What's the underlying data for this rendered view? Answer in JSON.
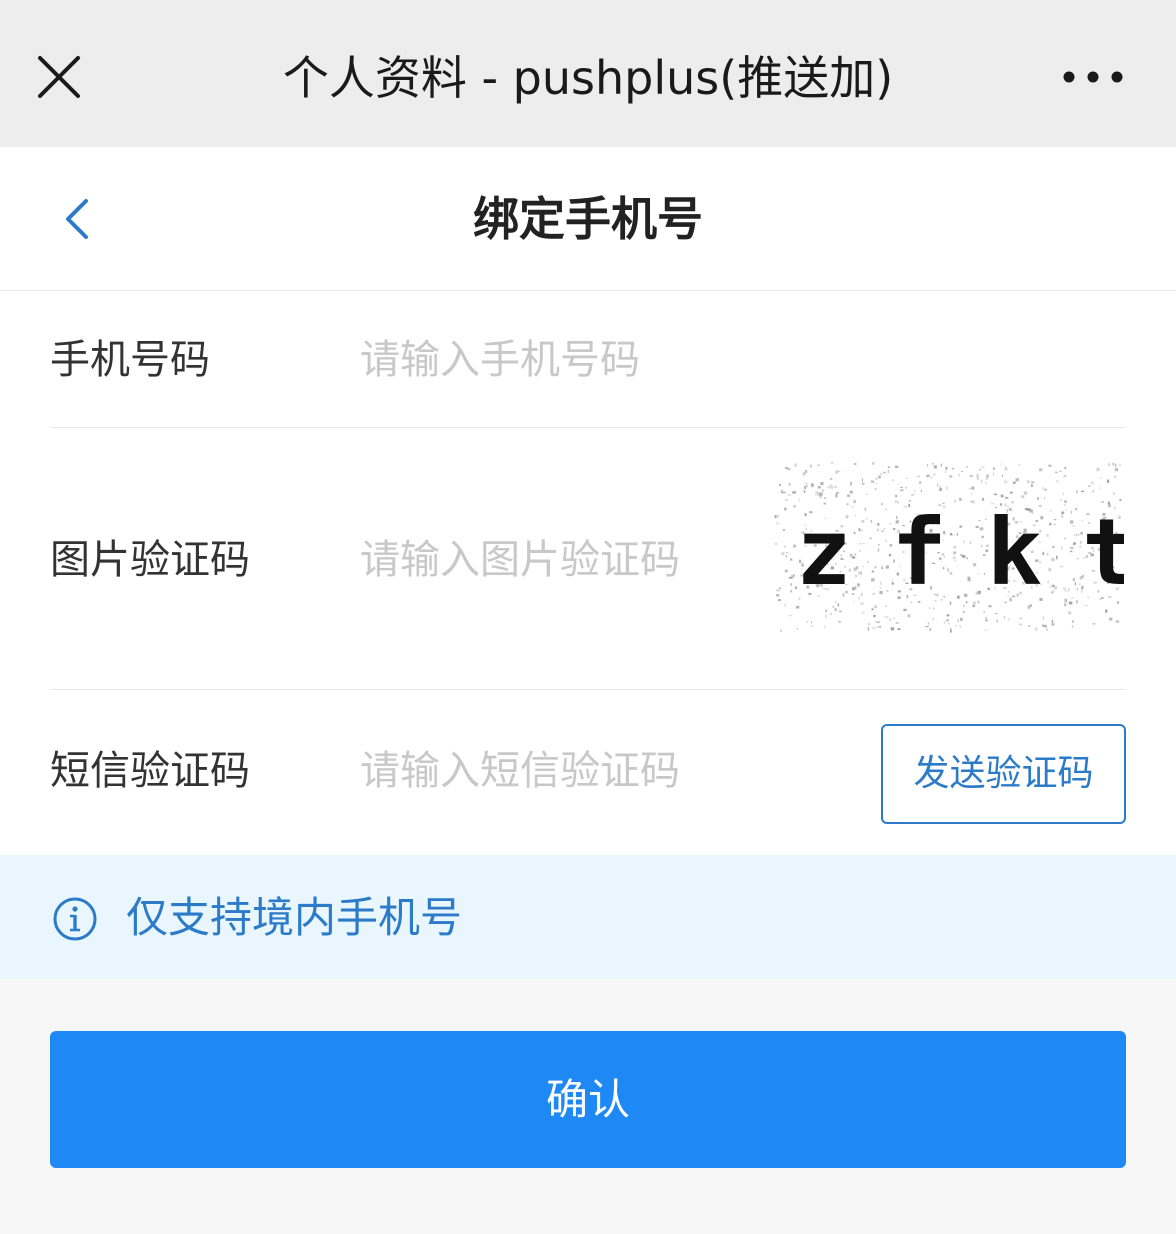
{
  "window": {
    "title": "个人资料 - pushplus(推送加)",
    "close_icon": "close-icon",
    "more_icon": "more-icon"
  },
  "nav": {
    "back_icon": "chevron-left-icon",
    "title": "绑定手机号"
  },
  "form": {
    "phone": {
      "label": "手机号码",
      "placeholder": "请输入手机号码"
    },
    "image_code": {
      "label": "图片验证码",
      "placeholder": "请输入图片验证码",
      "captcha_text": "zfkt"
    },
    "sms_code": {
      "label": "短信验证码",
      "placeholder": "请输入短信验证码",
      "send_button": "发送验证码"
    }
  },
  "notice": {
    "icon": "info-icon",
    "text": "仅支持境内手机号"
  },
  "confirm_button": "确认",
  "colors": {
    "accent": "#1e88f5",
    "link": "#2b7bc9",
    "notice_bg": "#e9f6fd",
    "topbar_bg": "#ededed"
  }
}
